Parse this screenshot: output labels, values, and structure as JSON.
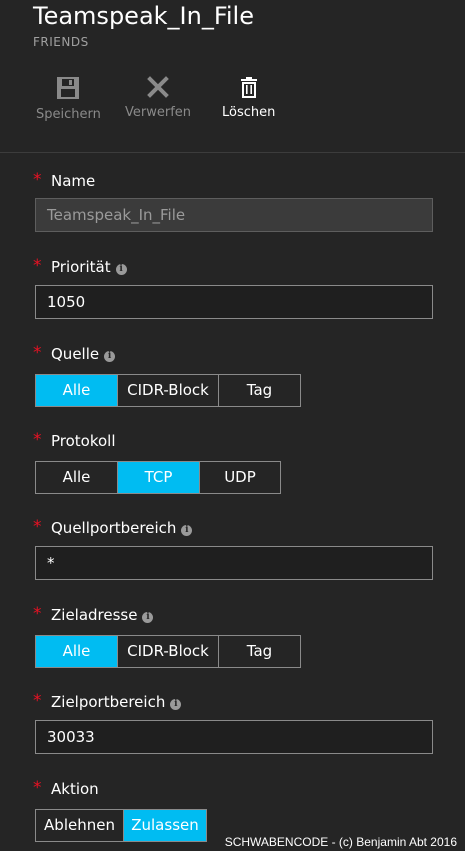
{
  "header": {
    "title": "Teamspeak_In_File",
    "subtitle": "FRIENDS"
  },
  "toolbar": {
    "save_label": "Speichern",
    "discard_label": "Verwerfen",
    "delete_label": "Löschen"
  },
  "form": {
    "required_mark": "*",
    "info_glyph": "i",
    "name": {
      "label": "Name",
      "value": "Teamspeak_In_File"
    },
    "priority": {
      "label": "Priorität",
      "value": "1050"
    },
    "source": {
      "label": "Quelle",
      "options": [
        "Alle",
        "CIDR-Block",
        "Tag"
      ],
      "selected": "Alle"
    },
    "protocol": {
      "label": "Protokoll",
      "options": [
        "Alle",
        "TCP",
        "UDP"
      ],
      "selected": "TCP"
    },
    "source_port_range": {
      "label": "Quellportbereich",
      "value": "*"
    },
    "destination": {
      "label": "Zieladresse",
      "options": [
        "Alle",
        "CIDR-Block",
        "Tag"
      ],
      "selected": "Alle"
    },
    "destination_port_range": {
      "label": "Zielportbereich",
      "value": "30033"
    },
    "action": {
      "label": "Aktion",
      "options": [
        "Ablehnen",
        "Zulassen"
      ],
      "selected": "Zulassen"
    }
  },
  "footer": {
    "text": "SCHWABENCODE - (c) Benjamin Abt 2016"
  },
  "colors": {
    "background": "#252525",
    "accent": "#00bcf2",
    "required": "#e81123",
    "muted_text": "#8a8a8a"
  },
  "icons": {
    "save": "save-icon",
    "discard": "close-icon",
    "delete": "trash-icon",
    "info": "info-icon"
  }
}
